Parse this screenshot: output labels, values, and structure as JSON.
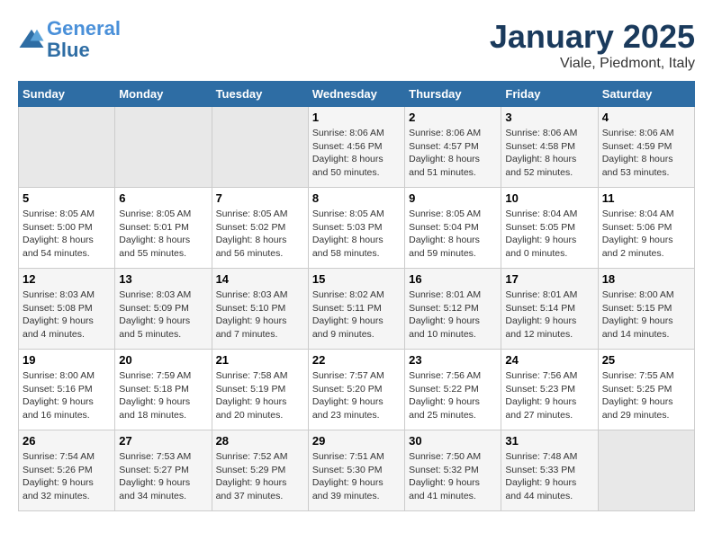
{
  "header": {
    "logo_line1": "General",
    "logo_line2": "Blue",
    "title": "January 2025",
    "subtitle": "Viale, Piedmont, Italy"
  },
  "weekdays": [
    "Sunday",
    "Monday",
    "Tuesday",
    "Wednesday",
    "Thursday",
    "Friday",
    "Saturday"
  ],
  "weeks": [
    [
      {
        "day": "",
        "sunrise": "",
        "sunset": "",
        "daylight": ""
      },
      {
        "day": "",
        "sunrise": "",
        "sunset": "",
        "daylight": ""
      },
      {
        "day": "",
        "sunrise": "",
        "sunset": "",
        "daylight": ""
      },
      {
        "day": "1",
        "sunrise": "Sunrise: 8:06 AM",
        "sunset": "Sunset: 4:56 PM",
        "daylight": "Daylight: 8 hours and 50 minutes."
      },
      {
        "day": "2",
        "sunrise": "Sunrise: 8:06 AM",
        "sunset": "Sunset: 4:57 PM",
        "daylight": "Daylight: 8 hours and 51 minutes."
      },
      {
        "day": "3",
        "sunrise": "Sunrise: 8:06 AM",
        "sunset": "Sunset: 4:58 PM",
        "daylight": "Daylight: 8 hours and 52 minutes."
      },
      {
        "day": "4",
        "sunrise": "Sunrise: 8:06 AM",
        "sunset": "Sunset: 4:59 PM",
        "daylight": "Daylight: 8 hours and 53 minutes."
      }
    ],
    [
      {
        "day": "5",
        "sunrise": "Sunrise: 8:05 AM",
        "sunset": "Sunset: 5:00 PM",
        "daylight": "Daylight: 8 hours and 54 minutes."
      },
      {
        "day": "6",
        "sunrise": "Sunrise: 8:05 AM",
        "sunset": "Sunset: 5:01 PM",
        "daylight": "Daylight: 8 hours and 55 minutes."
      },
      {
        "day": "7",
        "sunrise": "Sunrise: 8:05 AM",
        "sunset": "Sunset: 5:02 PM",
        "daylight": "Daylight: 8 hours and 56 minutes."
      },
      {
        "day": "8",
        "sunrise": "Sunrise: 8:05 AM",
        "sunset": "Sunset: 5:03 PM",
        "daylight": "Daylight: 8 hours and 58 minutes."
      },
      {
        "day": "9",
        "sunrise": "Sunrise: 8:05 AM",
        "sunset": "Sunset: 5:04 PM",
        "daylight": "Daylight: 8 hours and 59 minutes."
      },
      {
        "day": "10",
        "sunrise": "Sunrise: 8:04 AM",
        "sunset": "Sunset: 5:05 PM",
        "daylight": "Daylight: 9 hours and 0 minutes."
      },
      {
        "day": "11",
        "sunrise": "Sunrise: 8:04 AM",
        "sunset": "Sunset: 5:06 PM",
        "daylight": "Daylight: 9 hours and 2 minutes."
      }
    ],
    [
      {
        "day": "12",
        "sunrise": "Sunrise: 8:03 AM",
        "sunset": "Sunset: 5:08 PM",
        "daylight": "Daylight: 9 hours and 4 minutes."
      },
      {
        "day": "13",
        "sunrise": "Sunrise: 8:03 AM",
        "sunset": "Sunset: 5:09 PM",
        "daylight": "Daylight: 9 hours and 5 minutes."
      },
      {
        "day": "14",
        "sunrise": "Sunrise: 8:03 AM",
        "sunset": "Sunset: 5:10 PM",
        "daylight": "Daylight: 9 hours and 7 minutes."
      },
      {
        "day": "15",
        "sunrise": "Sunrise: 8:02 AM",
        "sunset": "Sunset: 5:11 PM",
        "daylight": "Daylight: 9 hours and 9 minutes."
      },
      {
        "day": "16",
        "sunrise": "Sunrise: 8:01 AM",
        "sunset": "Sunset: 5:12 PM",
        "daylight": "Daylight: 9 hours and 10 minutes."
      },
      {
        "day": "17",
        "sunrise": "Sunrise: 8:01 AM",
        "sunset": "Sunset: 5:14 PM",
        "daylight": "Daylight: 9 hours and 12 minutes."
      },
      {
        "day": "18",
        "sunrise": "Sunrise: 8:00 AM",
        "sunset": "Sunset: 5:15 PM",
        "daylight": "Daylight: 9 hours and 14 minutes."
      }
    ],
    [
      {
        "day": "19",
        "sunrise": "Sunrise: 8:00 AM",
        "sunset": "Sunset: 5:16 PM",
        "daylight": "Daylight: 9 hours and 16 minutes."
      },
      {
        "day": "20",
        "sunrise": "Sunrise: 7:59 AM",
        "sunset": "Sunset: 5:18 PM",
        "daylight": "Daylight: 9 hours and 18 minutes."
      },
      {
        "day": "21",
        "sunrise": "Sunrise: 7:58 AM",
        "sunset": "Sunset: 5:19 PM",
        "daylight": "Daylight: 9 hours and 20 minutes."
      },
      {
        "day": "22",
        "sunrise": "Sunrise: 7:57 AM",
        "sunset": "Sunset: 5:20 PM",
        "daylight": "Daylight: 9 hours and 23 minutes."
      },
      {
        "day": "23",
        "sunrise": "Sunrise: 7:56 AM",
        "sunset": "Sunset: 5:22 PM",
        "daylight": "Daylight: 9 hours and 25 minutes."
      },
      {
        "day": "24",
        "sunrise": "Sunrise: 7:56 AM",
        "sunset": "Sunset: 5:23 PM",
        "daylight": "Daylight: 9 hours and 27 minutes."
      },
      {
        "day": "25",
        "sunrise": "Sunrise: 7:55 AM",
        "sunset": "Sunset: 5:25 PM",
        "daylight": "Daylight: 9 hours and 29 minutes."
      }
    ],
    [
      {
        "day": "26",
        "sunrise": "Sunrise: 7:54 AM",
        "sunset": "Sunset: 5:26 PM",
        "daylight": "Daylight: 9 hours and 32 minutes."
      },
      {
        "day": "27",
        "sunrise": "Sunrise: 7:53 AM",
        "sunset": "Sunset: 5:27 PM",
        "daylight": "Daylight: 9 hours and 34 minutes."
      },
      {
        "day": "28",
        "sunrise": "Sunrise: 7:52 AM",
        "sunset": "Sunset: 5:29 PM",
        "daylight": "Daylight: 9 hours and 37 minutes."
      },
      {
        "day": "29",
        "sunrise": "Sunrise: 7:51 AM",
        "sunset": "Sunset: 5:30 PM",
        "daylight": "Daylight: 9 hours and 39 minutes."
      },
      {
        "day": "30",
        "sunrise": "Sunrise: 7:50 AM",
        "sunset": "Sunset: 5:32 PM",
        "daylight": "Daylight: 9 hours and 41 minutes."
      },
      {
        "day": "31",
        "sunrise": "Sunrise: 7:48 AM",
        "sunset": "Sunset: 5:33 PM",
        "daylight": "Daylight: 9 hours and 44 minutes."
      },
      {
        "day": "",
        "sunrise": "",
        "sunset": "",
        "daylight": ""
      }
    ]
  ]
}
